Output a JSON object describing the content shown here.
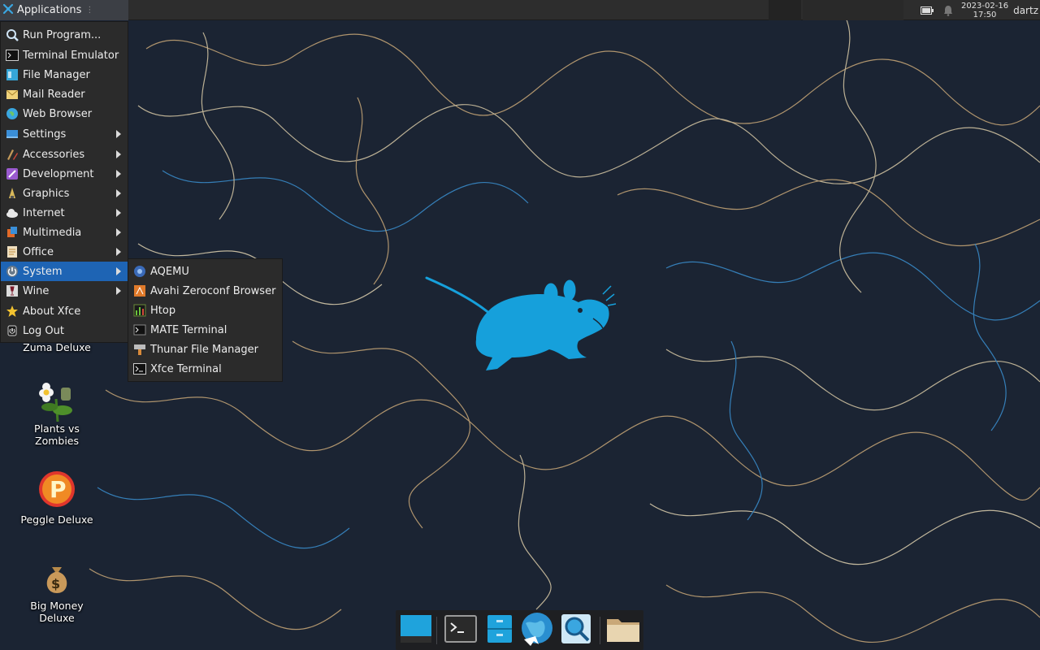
{
  "panel": {
    "applications_label": "Applications",
    "clock_date": "2023-02-16",
    "clock_time": "17:50",
    "user": "dartz"
  },
  "menu": {
    "items": [
      {
        "label": "Run Program...",
        "icon": "run-program-icon",
        "submenu": false
      },
      {
        "label": "Terminal Emulator",
        "icon": "terminal-icon",
        "submenu": false
      },
      {
        "label": "File Manager",
        "icon": "file-manager-icon",
        "submenu": false
      },
      {
        "label": "Mail Reader",
        "icon": "mail-icon",
        "submenu": false
      },
      {
        "label": "Web Browser",
        "icon": "globe-icon",
        "submenu": false
      },
      {
        "label": "Settings",
        "icon": "settings-icon",
        "submenu": true
      },
      {
        "label": "Accessories",
        "icon": "accessories-icon",
        "submenu": true
      },
      {
        "label": "Development",
        "icon": "development-icon",
        "submenu": true
      },
      {
        "label": "Graphics",
        "icon": "graphics-icon",
        "submenu": true
      },
      {
        "label": "Internet",
        "icon": "cloud-icon",
        "submenu": true
      },
      {
        "label": "Multimedia",
        "icon": "multimedia-icon",
        "submenu": true
      },
      {
        "label": "Office",
        "icon": "office-icon",
        "submenu": true
      },
      {
        "label": "System",
        "icon": "power-icon",
        "submenu": true
      },
      {
        "label": "Wine",
        "icon": "wine-icon",
        "submenu": true
      },
      {
        "label": "About Xfce",
        "icon": "star-icon",
        "submenu": false
      },
      {
        "label": "Log Out",
        "icon": "logout-icon",
        "submenu": false
      }
    ],
    "active": "System"
  },
  "submenu": {
    "items": [
      {
        "label": "AQEMU",
        "icon": "aqemu-icon"
      },
      {
        "label": "Avahi Zeroconf Browser",
        "icon": "avahi-icon"
      },
      {
        "label": "Htop",
        "icon": "htop-icon"
      },
      {
        "label": "MATE Terminal",
        "icon": "mate-terminal-icon"
      },
      {
        "label": "Thunar File Manager",
        "icon": "thunar-icon"
      },
      {
        "label": "Xfce Terminal",
        "icon": "xfce-terminal-icon"
      }
    ]
  },
  "desktop": {
    "icons": [
      {
        "label": "Zuma Deluxe",
        "icon": "zuma-icon"
      },
      {
        "label": "Plants vs Zombies",
        "icon": "plants-vs-zombies-icon"
      },
      {
        "label": "Peggle Deluxe",
        "icon": "peggle-icon"
      },
      {
        "label": "Big Money Deluxe",
        "icon": "big-money-icon"
      }
    ]
  },
  "dock": {
    "items": [
      "show-desktop-icon",
      "terminal-icon",
      "files-icon",
      "web-browser-icon",
      "search-icon",
      "folder-icon"
    ]
  },
  "colors": {
    "wallpaper": "#1b2433",
    "mouse": "#16a0db",
    "menu_bg": "#2b2b2b",
    "menu_active": "#1e64b4",
    "panel": "#2d2d2d"
  }
}
